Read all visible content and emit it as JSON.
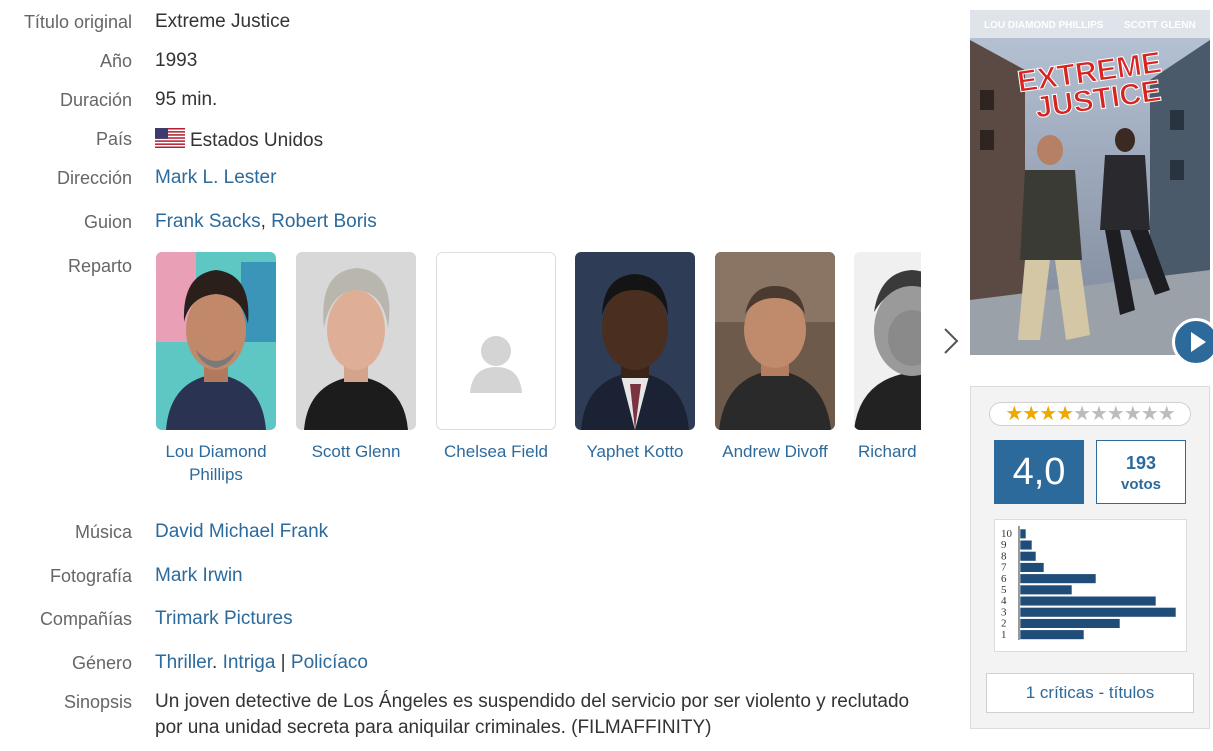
{
  "details": {
    "original_title": {
      "label": "Título original",
      "value": "Extreme Justice"
    },
    "year": {
      "label": "Año",
      "value": "1993"
    },
    "duration": {
      "label": "Duración",
      "value": "95 min."
    },
    "country": {
      "label": "País",
      "value": "Estados Unidos",
      "flag": "us-flag-icon"
    },
    "direction": {
      "label": "Dirección",
      "value": "Mark L. Lester"
    },
    "script": {
      "label": "Guion",
      "writers": [
        "Frank Sacks",
        "Robert Boris"
      ],
      "separator": ","
    },
    "cast": {
      "label": "Reparto",
      "members": [
        {
          "name": "Lou Diamond Phillips"
        },
        {
          "name": "Scott Glenn"
        },
        {
          "name": "Chelsea Field"
        },
        {
          "name": "Yaphet Kotto"
        },
        {
          "name": "Andrew Divoff"
        },
        {
          "name": "Richard"
        }
      ]
    },
    "music": {
      "label": "Música",
      "value": "David Michael Frank"
    },
    "photography": {
      "label": "Fotografía",
      "value": "Mark Irwin"
    },
    "companies": {
      "label": "Compañías",
      "value": "Trimark Pictures"
    },
    "genre": {
      "label": "Género",
      "genres": [
        "Thriller",
        "Intriga",
        "Policíaco"
      ],
      "dot": ".",
      "bar": "|"
    },
    "synopsis": {
      "label": "Sinopsis",
      "value": "Un joven detective de Los Ángeles es suspendido del servicio por ser violento y reclutado por una unidad secreta para aniquilar criminales. (FILMAFFINITY)"
    }
  },
  "poster": {
    "actor_left": "LOU DIAMOND PHILLIPS",
    "actor_right": "SCOTT GLENN",
    "title_line1": "EXTREME",
    "title_line2": "JUSTICE"
  },
  "rating": {
    "stars_filled": 4,
    "stars_total": 10,
    "score": "4,0",
    "votes_count": "193",
    "votes_label": "votos",
    "histogram": {
      "labels": [
        "10",
        "9",
        "8",
        "7",
        "6",
        "5",
        "4",
        "3",
        "2",
        "1"
      ],
      "values": [
        3,
        6,
        8,
        12,
        38,
        26,
        68,
        78,
        50,
        32
      ]
    },
    "critics_link": "1 críticas - títulos"
  },
  "colors": {
    "accent": "#2c6a9c",
    "bar": "#1f4d78",
    "star": "#f0a800"
  }
}
